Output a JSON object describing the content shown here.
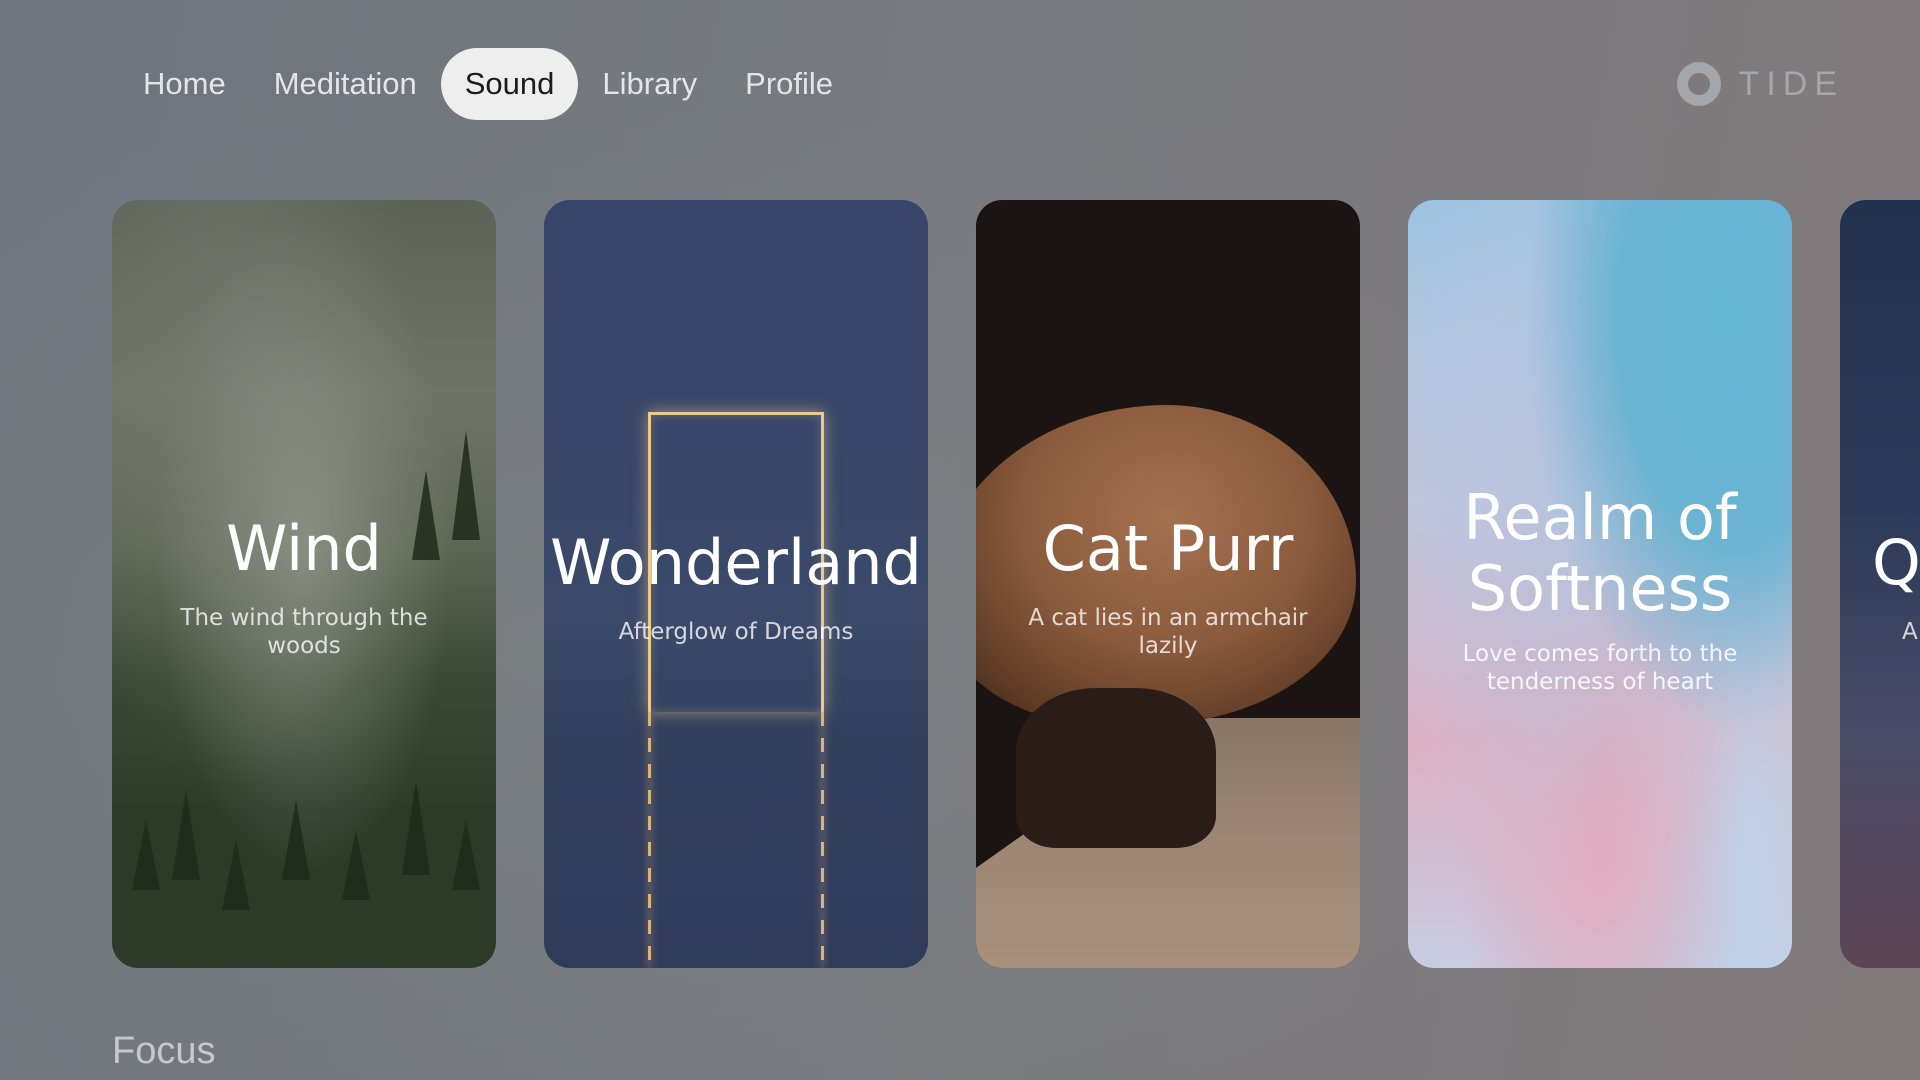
{
  "nav": {
    "items": [
      {
        "label": "Home"
      },
      {
        "label": "Meditation"
      },
      {
        "label": "Sound",
        "active": true
      },
      {
        "label": "Library"
      },
      {
        "label": "Profile"
      }
    ]
  },
  "brand": {
    "name": "TIDE",
    "icon": "ring-logo-icon"
  },
  "cards": [
    {
      "title": "Wind",
      "subtitle": "The wind through the woods"
    },
    {
      "title": "Wonderland",
      "subtitle": "Afterglow of Dreams"
    },
    {
      "title": "Cat Purr",
      "subtitle": "A cat lies in an armchair lazily"
    },
    {
      "title": "Realm of Softness",
      "subtitle": "Love comes forth to the tenderness of heart"
    },
    {
      "title": "Q",
      "subtitle": "A"
    }
  ],
  "section": {
    "label": "Focus"
  },
  "colors": {
    "active_tab_bg": "#eeeeee",
    "brand": "#a3a6ab"
  }
}
